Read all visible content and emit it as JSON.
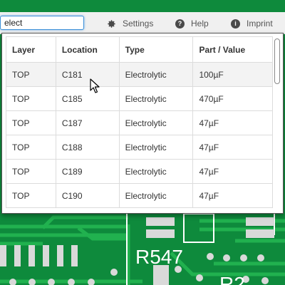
{
  "search": {
    "value": "elect"
  },
  "toolbar": {
    "settings": {
      "label": "Settings",
      "icon": "gear-icon"
    },
    "help": {
      "label": "Help",
      "icon": "question-circle-icon"
    },
    "imprint": {
      "label": "Imprint",
      "icon": "info-circle-icon"
    }
  },
  "results": {
    "headers": [
      "Layer",
      "Location",
      "Type",
      "Part / Value"
    ],
    "rows": [
      [
        "TOP",
        "C181",
        "Electrolytic",
        "100µF"
      ],
      [
        "TOP",
        "C185",
        "Electrolytic",
        "470µF"
      ],
      [
        "TOP",
        "C187",
        "Electrolytic",
        "47µF"
      ],
      [
        "TOP",
        "C188",
        "Electrolytic",
        "47µF"
      ],
      [
        "TOP",
        "C189",
        "Electrolytic",
        "47µF"
      ],
      [
        "TOP",
        "C190",
        "Electrolytic",
        "47µF"
      ]
    ]
  },
  "board": {
    "silkscreen_label": "R547",
    "partial_label": "R2"
  },
  "colors": {
    "pcb_green": "#0e8a3c",
    "trace_green": "#22b04e",
    "silkscreen": "#ffffff",
    "pad": "#d8d8d8"
  }
}
